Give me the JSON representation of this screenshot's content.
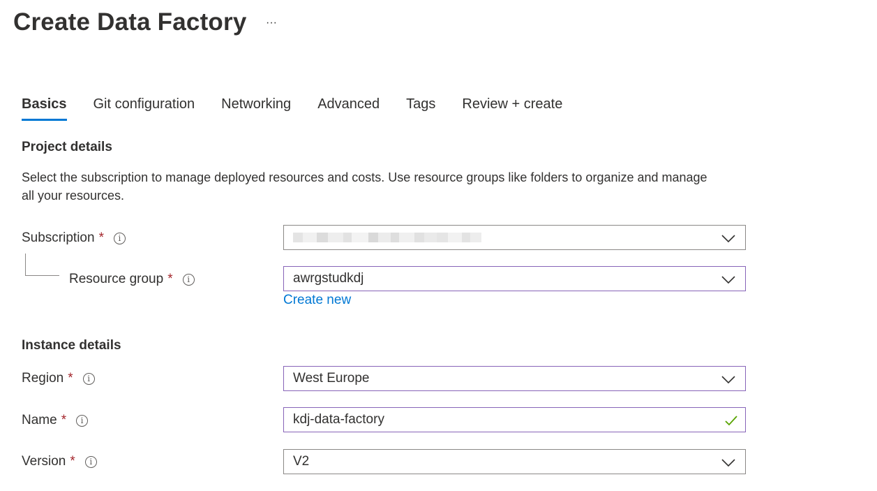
{
  "header": {
    "title": "Create Data Factory",
    "more_label": "···"
  },
  "tabs": [
    {
      "label": "Basics",
      "active": true
    },
    {
      "label": "Git configuration",
      "active": false
    },
    {
      "label": "Networking",
      "active": false
    },
    {
      "label": "Advanced",
      "active": false
    },
    {
      "label": "Tags",
      "active": false
    },
    {
      "label": "Review + create",
      "active": false
    }
  ],
  "project": {
    "heading": "Project details",
    "description": "Select the subscription to manage deployed resources and costs. Use resource groups like folders to organize and manage all your resources.",
    "subscription": {
      "label": "Subscription",
      "required_mark": "*",
      "info": "i",
      "value_redacted": true
    },
    "resource_group": {
      "label": "Resource group",
      "required_mark": "*",
      "info": "i",
      "value": "awrgstudkdj",
      "create_new_label": "Create new"
    }
  },
  "instance": {
    "heading": "Instance details",
    "region": {
      "label": "Region",
      "required_mark": "*",
      "info": "i",
      "value": "West Europe"
    },
    "name": {
      "label": "Name",
      "required_mark": "*",
      "info": "i",
      "value": "kdj-data-factory",
      "valid": true
    },
    "version": {
      "label": "Version",
      "required_mark": "*",
      "info": "i",
      "value": "V2"
    }
  },
  "colors": {
    "accent": "#0078d4",
    "required": "#a4262c",
    "focus_border": "#8764b8",
    "valid_check": "#57a300"
  },
  "icons": {
    "dropdown": "chevron-down-icon",
    "info": "info-icon",
    "valid": "checkmark-icon",
    "more": "more-icon"
  }
}
